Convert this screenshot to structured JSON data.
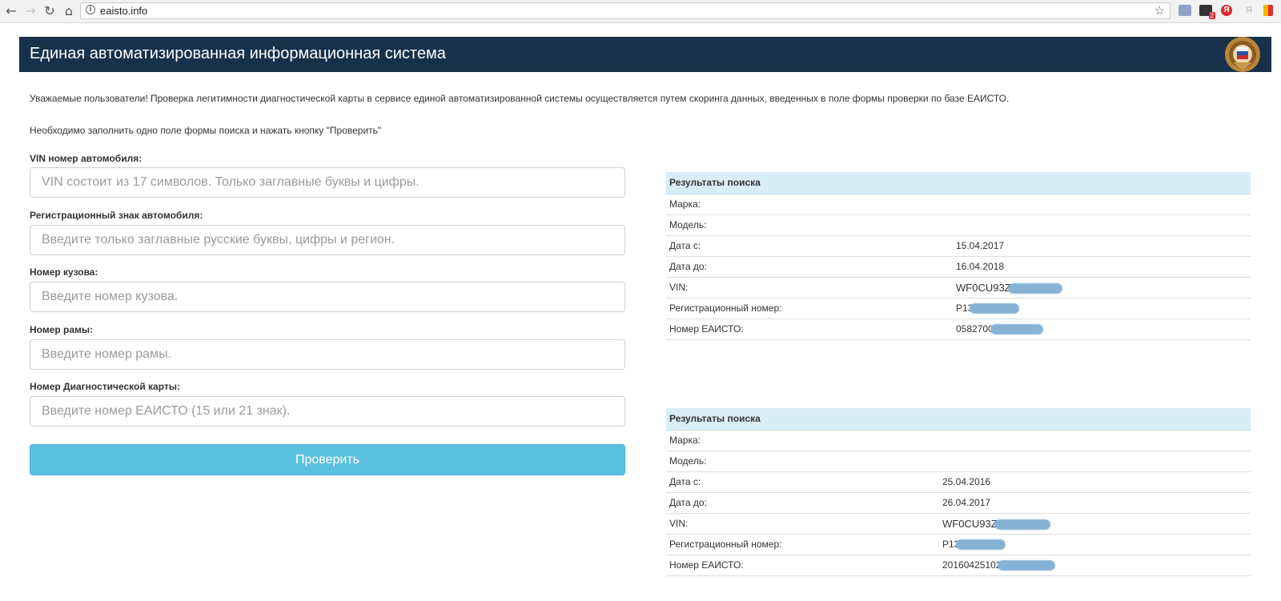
{
  "browser": {
    "url": "eaisto.info",
    "ext_badge": "2",
    "ext_y": "Я",
    "ext_y2": "Я"
  },
  "header": {
    "title": "Единая автоматизированная информационная система"
  },
  "notice": "Уважаемые пользователи! Проверка легитимности диагностической карты в сервисе единой автоматизированной системы осуществляется путем скоринга данных, введенных в поле формы проверки по базе ЕАИСТО.",
  "hint": "Необходимо заполнить одно поле формы поиска и нажать кнопку \"Проверить\"",
  "form": {
    "vin_label": "VIN номер автомобиля:",
    "vin_placeholder": "VIN состоит из 17 символов. Только заглавные буквы и цифры.",
    "reg_label": "Регистрационный знак автомобиля:",
    "reg_placeholder": "Введите только заглавные русские буквы, цифры и регион.",
    "body_label": "Номер кузова:",
    "body_placeholder": "Введите номер кузова.",
    "frame_label": "Номер рамы:",
    "frame_placeholder": "Введите номер рамы.",
    "card_label": "Номер Диагностической карты:",
    "card_placeholder": "Введите номер ЕАИСТО (15 или 21 знак).",
    "submit_label": "Проверить"
  },
  "results": [
    {
      "heading": "Результаты поиска",
      "rows": [
        {
          "key": "Марка:",
          "value": ""
        },
        {
          "key": "Модель:",
          "value": ""
        },
        {
          "key": "Дата с:",
          "value": "15.04.2017"
        },
        {
          "key": "Дата до:",
          "value": "16.04.2018"
        },
        {
          "key": "VIN:",
          "value": "WF0CU93Z",
          "redacted": true
        },
        {
          "key": "Регистрационный номер:",
          "value": "Р13",
          "redacted": true
        },
        {
          "key": "Номер ЕАИСТО:",
          "value": "0582700",
          "redacted": true
        }
      ]
    },
    {
      "heading": "Результаты поиска",
      "rows": [
        {
          "key": "Марка:",
          "value": ""
        },
        {
          "key": "Модель:",
          "value": ""
        },
        {
          "key": "Дата с:",
          "value": "25.04.2016"
        },
        {
          "key": "Дата до:",
          "value": "26.04.2017"
        },
        {
          "key": "VIN:",
          "value": "WF0CU93Z",
          "redacted": true
        },
        {
          "key": "Регистрационный номер:",
          "value": "Р13",
          "redacted": true
        },
        {
          "key": "Номер ЕАИСТО:",
          "value": "20160425102",
          "redacted": true
        }
      ]
    }
  ]
}
